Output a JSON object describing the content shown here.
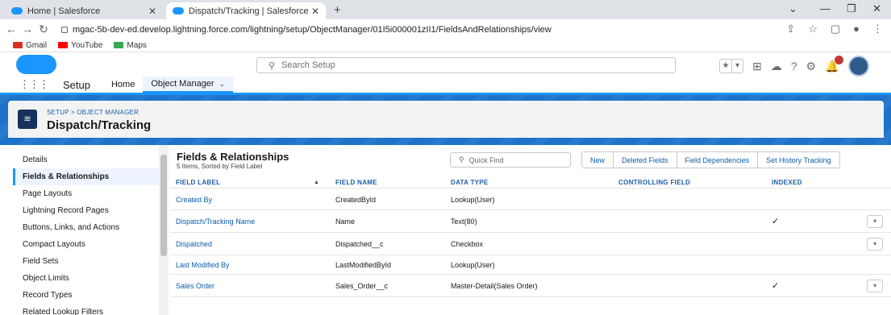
{
  "browser": {
    "tabs": [
      {
        "title": "Home | Salesforce"
      },
      {
        "title": "Dispatch/Tracking | Salesforce"
      }
    ],
    "url": "mgac-5b-dev-ed.develop.lightning.force.com/lightning/setup/ObjectManager/01I5i000001zII1/FieldsAndRelationships/view",
    "bookmarks": [
      "Gmail",
      "YouTube",
      "Maps"
    ]
  },
  "header": {
    "search_placeholder": "Search Setup"
  },
  "context": {
    "app_name": "Setup",
    "nav_tabs": [
      {
        "label": "Home"
      },
      {
        "label": "Object Manager"
      }
    ]
  },
  "object": {
    "breadcrumb": "SETUP > OBJECT MANAGER",
    "title": "Dispatch/Tracking"
  },
  "sidebar": {
    "items": [
      {
        "label": "Details"
      },
      {
        "label": "Fields & Relationships"
      },
      {
        "label": "Page Layouts"
      },
      {
        "label": "Lightning Record Pages"
      },
      {
        "label": "Buttons, Links, and Actions"
      },
      {
        "label": "Compact Layouts"
      },
      {
        "label": "Field Sets"
      },
      {
        "label": "Object Limits"
      },
      {
        "label": "Record Types"
      },
      {
        "label": "Related Lookup Filters"
      }
    ]
  },
  "panel": {
    "title": "Fields & Relationships",
    "subtitle": "5 Items, Sorted by Field Label",
    "quick_find_placeholder": "Quick Find",
    "buttons": [
      "New",
      "Deleted Fields",
      "Field Dependencies",
      "Set History Tracking"
    ],
    "columns": [
      "FIELD LABEL",
      "FIELD NAME",
      "DATA TYPE",
      "CONTROLLING FIELD",
      "INDEXED"
    ],
    "rows": [
      {
        "label": "Created By",
        "name": "CreatedById",
        "type": "Lookup(User)",
        "controlling": "",
        "indexed": ""
      },
      {
        "label": "Dispatch/Tracking Name",
        "name": "Name",
        "type": "Text(80)",
        "controlling": "",
        "indexed": "✓"
      },
      {
        "label": "Dispatched",
        "name": "Dispatched__c",
        "type": "Checkbox",
        "controlling": "",
        "indexed": ""
      },
      {
        "label": "Last Modified By",
        "name": "LastModifiedById",
        "type": "Lookup(User)",
        "controlling": "",
        "indexed": ""
      },
      {
        "label": "Sales Order",
        "name": "Sales_Order__c",
        "type": "Master-Detail(Sales Order)",
        "controlling": "",
        "indexed": "✓"
      }
    ]
  }
}
